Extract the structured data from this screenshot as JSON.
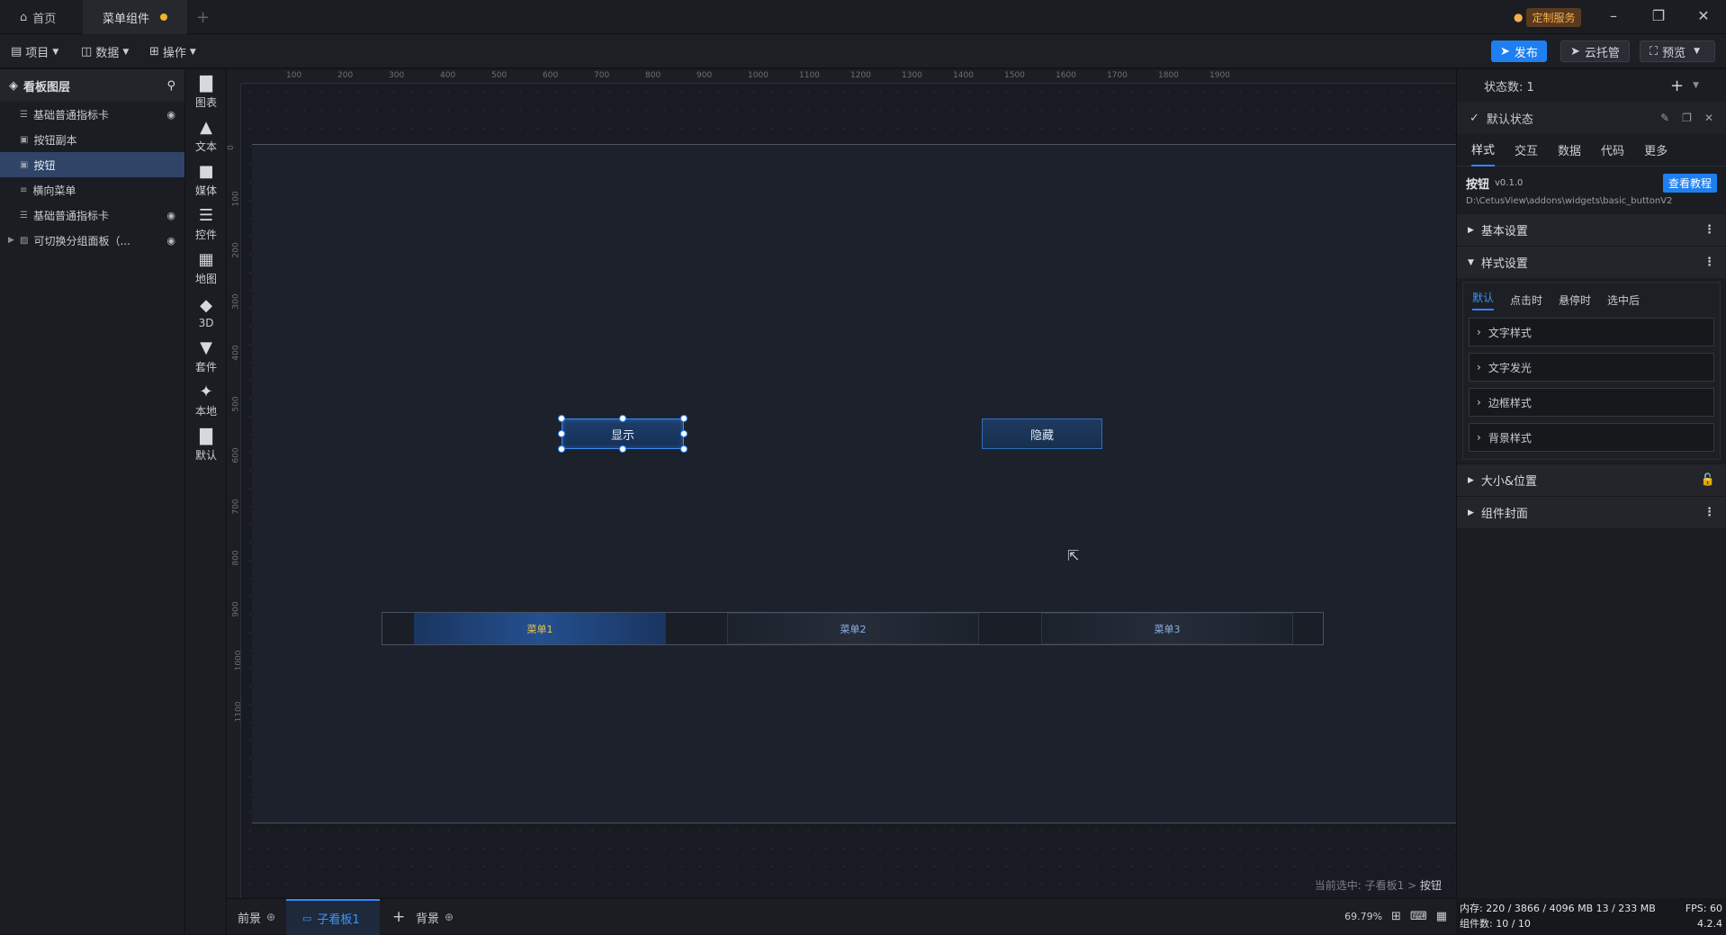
{
  "titlebar": {
    "tabs": [
      {
        "label": "首页",
        "icon": "home-icon"
      },
      {
        "label": "菜单组件",
        "unsaved": true
      }
    ],
    "custom_service": "定制服务"
  },
  "toolbar": {
    "menus": [
      {
        "label": "项目",
        "icon": "file-icon"
      },
      {
        "label": "数据",
        "icon": "database-icon"
      },
      {
        "label": "操作",
        "icon": "grid-icon"
      }
    ],
    "publish": "发布",
    "cloud": "云托管",
    "preview": "预览"
  },
  "layers": {
    "title": "看板图层",
    "items": [
      {
        "label": "基础普通指标卡",
        "icon": "chart-layer-icon",
        "eye": true
      },
      {
        "label": "按钮副本",
        "icon": "image-layer-icon"
      },
      {
        "label": "按钮",
        "icon": "image-layer-icon",
        "selected": true
      },
      {
        "label": "横向菜单",
        "icon": "menu-layer-icon"
      },
      {
        "label": "基础普通指标卡",
        "icon": "chart-layer-icon",
        "eye": true
      },
      {
        "label": "可切换分组面板（...",
        "icon": "group-layer-icon",
        "eye": true,
        "expandable": true
      }
    ]
  },
  "components": [
    {
      "label": "图表",
      "icon": "bar-chart-icon"
    },
    {
      "label": "文本",
      "icon": "text-icon"
    },
    {
      "label": "媒体",
      "icon": "media-icon"
    },
    {
      "label": "控件",
      "icon": "control-icon"
    },
    {
      "label": "地图",
      "icon": "map-icon"
    },
    {
      "label": "3D",
      "icon": "cube-icon"
    },
    {
      "label": "套件",
      "icon": "shirt-icon"
    },
    {
      "label": "本地",
      "icon": "puzzle-icon"
    },
    {
      "label": "默认",
      "icon": "bar-chart-icon"
    }
  ],
  "ruler": {
    "top_labels": [
      "100",
      "200",
      "300",
      "400",
      "500",
      "600",
      "700",
      "800",
      "900",
      "1000",
      "1100",
      "1200",
      "1300",
      "1400",
      "1500",
      "1600",
      "1700",
      "1800",
      "1900"
    ],
    "left_labels": [
      "0",
      "100",
      "200",
      "300",
      "400",
      "500",
      "600",
      "700",
      "800",
      "900",
      "1000",
      "1100"
    ]
  },
  "canvas": {
    "show_button": "显示",
    "hide_button": "隐藏",
    "menu_items": [
      "菜单1",
      "菜单2",
      "菜单3"
    ],
    "selection_prefix": "当前选中: 子看板1 > ",
    "selection_target": "按钮"
  },
  "bottombar": {
    "tabs": [
      "前景",
      "子看板1",
      "背景"
    ],
    "zoom": "69.79%"
  },
  "right_panel": {
    "state_count_label": "状态数: 1",
    "default_state": "默认状态",
    "tabs": [
      "样式",
      "交互",
      "数据",
      "代码",
      "更多"
    ],
    "widget_name": "按钮",
    "widget_version": "v0.1.0",
    "tutorial": "查看教程",
    "widget_path": "D:\\CetusView\\addons\\widgets\\basic_buttonV2",
    "sections": {
      "basic": "基本设置",
      "style": "样式设置",
      "size": "大小&位置",
      "cover": "组件封面"
    },
    "style_state_tabs": [
      "默认",
      "点击时",
      "悬停时",
      "选中后"
    ],
    "style_items": [
      "文字样式",
      "文字发光",
      "边框样式",
      "背景样式"
    ]
  },
  "status": {
    "memory": "内存: 220 / 3866 / 4096 MB  13 / 233 MB",
    "fps": "FPS: 60",
    "count": "组件数: 10 / 10",
    "version": "4.2.4"
  },
  "colors": {
    "accent": "#2f88ff",
    "warning": "#f0b429",
    "canvas_bg": "#1c212b"
  }
}
